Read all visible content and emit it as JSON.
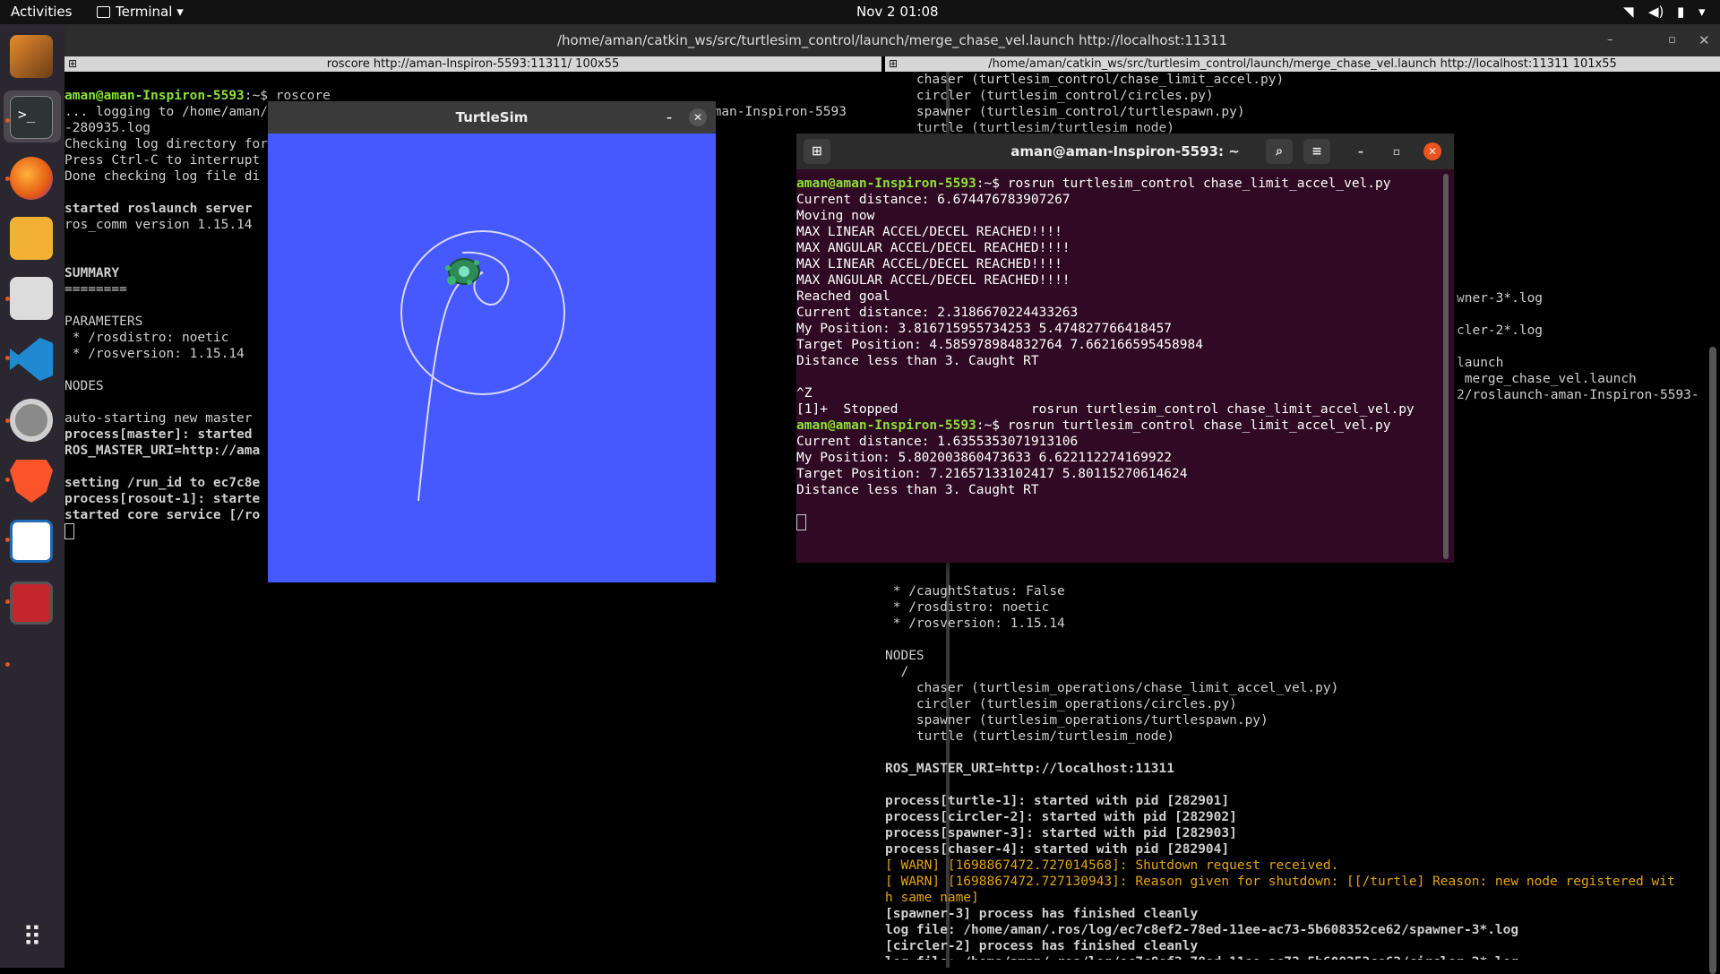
{
  "topbar": {
    "activities": "Activities",
    "app_name": "Terminal",
    "datetime": "Nov 2  01:08"
  },
  "main_window": {
    "title": "/home/aman/catkin_ws/src/turtlesim_control/launch/merge_chase_vel.launch http://localhost:11311"
  },
  "left_pane": {
    "header": "roscore http://aman-Inspiron-5593:11311/ 100x55",
    "prompt_user": "aman@aman-Inspiron-5593",
    "prompt_tail": ":~$ roscore",
    "lines": [
      "... logging to /home/aman/.ros/log/ec7c8ef2-78ed-11ee-ac73-5b608352ce62/roslaunch-aman-Inspiron-5593",
      "-280935.log",
      "Checking log directory for",
      "Press Ctrl-C to interrupt",
      "Done checking log file di",
      "",
      "started roslaunch server",
      "ros_comm version 1.15.14",
      "",
      "",
      "SUMMARY",
      "========",
      "",
      "PARAMETERS",
      " * /rosdistro: noetic",
      " * /rosversion: 1.15.14",
      "",
      "NODES",
      "",
      "auto-starting new master",
      "process[master]: started",
      "ROS_MASTER_URI=http://ama",
      "",
      "setting /run_id to ec7c8e",
      "process[rosout-1]: starte",
      "started core service [/ro"
    ]
  },
  "right_pane": {
    "header": "/home/aman/catkin_ws/src/turtlesim_control/launch/merge_chase_vel.launch http://localhost:11311 101x55",
    "top_lines": [
      "    chaser (turtlesim_control/chase_limit_accel.py)",
      "    circler (turtlesim_control/circles.py)",
      "    spawner (turtlesim_control/turtlespawn.py)",
      "    turtle (turtlesim/turtlesim_node)"
    ],
    "partial_lines": [
      "wner-3*.log",
      "",
      "cler-2*.log",
      "",
      "launch",
      " merge_chase_vel.launch",
      "2/roslaunch-aman-Inspiron-5593-"
    ],
    "bottom_lines": [
      " * /caughtStatus: False",
      " * /rosdistro: noetic",
      " * /rosversion: 1.15.14",
      "",
      "NODES",
      "  /",
      "    chaser (turtlesim_operations/chase_limit_accel_vel.py)",
      "    circler (turtlesim_operations/circles.py)",
      "    spawner (turtlesim_operations/turtlespawn.py)",
      "    turtle (turtlesim/turtlesim_node)",
      "",
      "ROS_MASTER_URI=http://localhost:11311",
      "",
      "process[turtle-1]: started with pid [282901]",
      "process[circler-2]: started with pid [282902]",
      "process[spawner-3]: started with pid [282903]",
      "process[chaser-4]: started with pid [282904]"
    ],
    "warn_lines": [
      "[ WARN] [1698867472.727014568]: Shutdown request received.",
      "[ WARN] [1698867472.727130943]: Reason given for shutdown: [[/turtle] Reason: new node registered wit",
      "h same name]"
    ],
    "end_lines": [
      "[spawner-3] process has finished cleanly",
      "log file: /home/aman/.ros/log/ec7c8ef2-78ed-11ee-ac73-5b608352ce62/spawner-3*.log",
      "[circler-2] process has finished cleanly",
      "log file: /home/aman/.ros/log/ec7c8ef2-78ed-11ee-ac73-5b608352ce62/circler-2*.log"
    ]
  },
  "turtlesim": {
    "title": "TurtleSim",
    "background": "#4559ff"
  },
  "gnome_terminal": {
    "title": "aman@aman-Inspiron-5593: ~",
    "prompt_user": "aman@aman-Inspiron-5593",
    "cmd1": ":~$ rosrun turtlesim_control chase_limit_accel_vel.py",
    "out1": [
      "Current distance: 6.674476783907267",
      "Moving now",
      "MAX LINEAR ACCEL/DECEL REACHED!!!!",
      "MAX ANGULAR ACCEL/DECEL REACHED!!!!",
      "MAX LINEAR ACCEL/DECEL REACHED!!!!",
      "MAX ANGULAR ACCEL/DECEL REACHED!!!!",
      "Reached goal",
      "Current distance: 2.3186670224433263",
      "My Position: 3.816715955734253 5.474827766418457",
      "Target Position: 4.585978984832764 7.662166595458984",
      "Distance less than 3. Caught RT",
      "",
      "^Z",
      "[1]+  Stopped                 rosrun turtlesim_control chase_limit_accel_vel.py"
    ],
    "cmd2": ":~$ rosrun turtlesim_control chase_limit_accel_vel.py",
    "out2": [
      "Current distance: 1.6355353071913106",
      "My Position: 5.802003860473633 6.622112274169922",
      "Target Position: 7.21657133102417 5.80115270614624",
      "Distance less than 3. Caught RT"
    ]
  },
  "colors": {
    "prompt_green": "#8ae234",
    "warn_orange": "#e5a50a",
    "ubuntu_terminal_bg": "#300a24"
  }
}
